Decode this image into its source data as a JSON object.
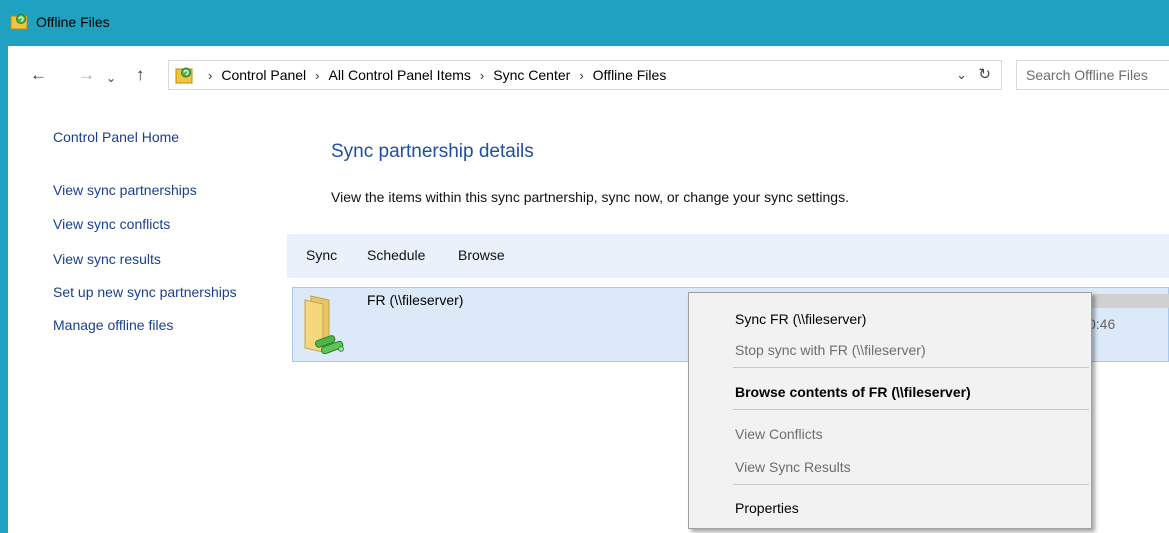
{
  "window": {
    "title": "Offline Files",
    "icon": "sync-center-icon"
  },
  "nav": {
    "back": "←",
    "forward": "→",
    "recent": "⌄",
    "up": "↑"
  },
  "address": {
    "icon": "sync-center-icon",
    "breadcrumbs": [
      "Control Panel",
      "All Control Panel Items",
      "Sync Center",
      "Offline Files"
    ],
    "separator": "›",
    "dropdown": "⌄",
    "refresh": "↻"
  },
  "search": {
    "placeholder": "Search Offline Files"
  },
  "sidebar": {
    "home": "Control Panel Home",
    "links": [
      "View sync partnerships",
      "View sync conflicts",
      "View sync results",
      "Set up new sync partnerships",
      "Manage offline files"
    ]
  },
  "main": {
    "heading": "Sync partnership details",
    "description": "View the items within this sync partnership, sync now, or change your sync settings.",
    "toolbar": [
      "Sync",
      "Schedule",
      "Browse"
    ],
    "partnership": {
      "name": "FR (\\\\fileserver)",
      "time_fragment": "0:46",
      "icon": "offline-folder-icon"
    }
  },
  "context_menu": {
    "items": [
      {
        "label": "Sync FR (\\\\fileserver)",
        "state": "enabled"
      },
      {
        "label": "Stop sync with FR (\\\\fileserver)",
        "state": "disabled"
      },
      {
        "label": "Browse contents of FR (\\\\fileserver)",
        "state": "default-bold"
      },
      {
        "label": "View Conflicts",
        "state": "disabled"
      },
      {
        "label": "View Sync Results",
        "state": "disabled"
      },
      {
        "label": "Properties",
        "state": "enabled"
      }
    ]
  },
  "colors": {
    "titlebar": "#1fa1c1",
    "link": "#1a3f8f",
    "heading": "#1e4fa0",
    "selection": "#dce9f8"
  }
}
